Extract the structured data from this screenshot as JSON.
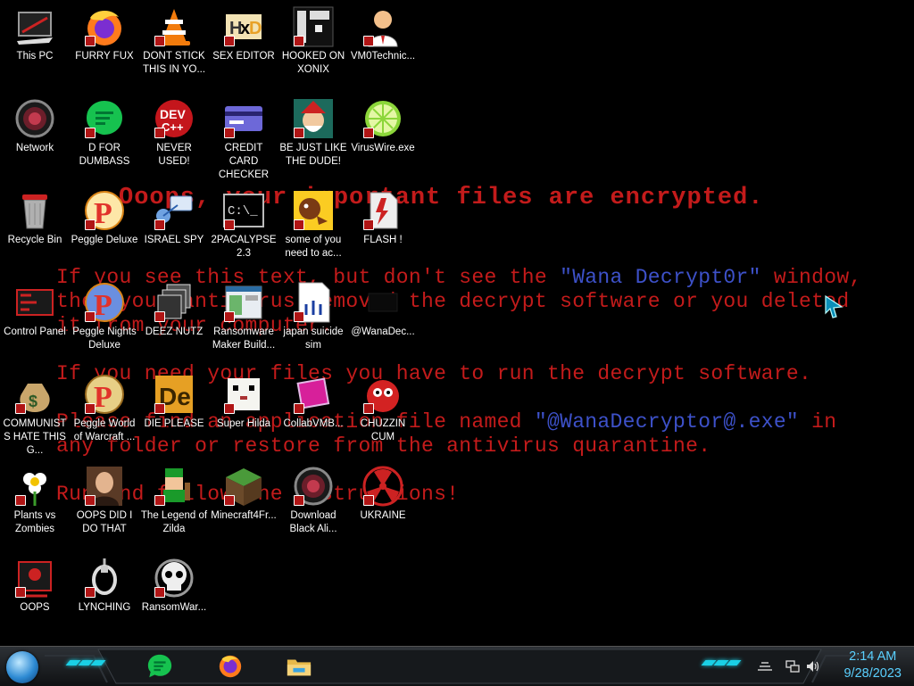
{
  "wallpaper": {
    "title": "Ooops, your important files are encrypted.",
    "p1_a": "If you see this text, but don't see the ",
    "p1_name": "\"Wana Decrypt0r\"",
    "p1_b": " window,",
    "p1_line2": "then your antivirus removed the decrypt software or you deleted",
    "p1_line3": "it from your computer.",
    "p2": "If you need your files you have to run the decrypt software.",
    "p3_a": "Please find an application file named ",
    "p3_name": "\"@WanaDecryptor@.exe\"",
    "p3_b": " in",
    "p3_line2": "any folder or restore from the antivirus quarantine.",
    "p4": "Run and follow the instructions!"
  },
  "icons": [
    {
      "label": "This PC",
      "icon": "this-pc-icon"
    },
    {
      "label": "FURRY FUX",
      "icon": "firefox-icon"
    },
    {
      "label": "DONT STICK THIS IN YO...",
      "icon": "vlc-cone-icon"
    },
    {
      "label": "SEX EDITOR",
      "icon": "hxd-editor-icon"
    },
    {
      "label": "HOOKED ON XONIX",
      "icon": "xonix-icon"
    },
    {
      "label": "VM0Technic...",
      "icon": "doctor-icon"
    },
    {
      "label": "Network",
      "icon": "network-orb-icon"
    },
    {
      "label": "D FOR DUMBASS",
      "icon": "green-chat-icon"
    },
    {
      "label": "NEVER USED!",
      "icon": "dev-cpp-icon"
    },
    {
      "label": "CREDIT CARD CHECKER",
      "icon": "credit-card-icon"
    },
    {
      "label": "BE JUST LIKE THE DUDE!",
      "icon": "santa-dude-icon"
    },
    {
      "label": "VirusWire.exe",
      "icon": "lime-icon"
    },
    {
      "label": "Recycle Bin",
      "icon": "recycle-bin-icon"
    },
    {
      "label": "Peggle Deluxe",
      "icon": "peggle-icon"
    },
    {
      "label": "ISRAEL SPY",
      "icon": "spy-network-icon"
    },
    {
      "label": "2PACALYPSE 2.3",
      "icon": "terminal-icon"
    },
    {
      "label": "some of you need to ac...",
      "icon": "dog-icon"
    },
    {
      "label": "FLASH !",
      "icon": "flash-page-icon"
    },
    {
      "label": "Control Panel",
      "icon": "control-panel-icon"
    },
    {
      "label": "Peggle Nights Deluxe",
      "icon": "peggle-nights-icon"
    },
    {
      "label": "DEEZ NUTZ",
      "icon": "stacked-windows-icon"
    },
    {
      "label": "Ransomware Maker Build...",
      "icon": "app-window-icon"
    },
    {
      "label": "japan suicide sim",
      "icon": "document-icon"
    },
    {
      "label": "@WanaDec...",
      "icon": "wana-decryptor-icon"
    },
    {
      "label": "COMMUNISTS HATE THIS G...",
      "icon": "money-bag-icon"
    },
    {
      "label": "Peggle World of Warcraft ...",
      "icon": "peggle-wow-icon"
    },
    {
      "label": "DIE PLEASE",
      "icon": "de-icon"
    },
    {
      "label": "Super Hilda",
      "icon": "pixel-cat-icon"
    },
    {
      "label": "CollabVMB...",
      "icon": "collabvm-icon"
    },
    {
      "label": "CHUZZIN CUM",
      "icon": "chuzzle-icon"
    },
    {
      "label": "Plants vs Zombies",
      "icon": "flower-icon"
    },
    {
      "label": "OOPS DID I DO THAT",
      "icon": "portrait-icon"
    },
    {
      "label": "The Legend of Zilda",
      "icon": "zelda-sprite-icon"
    },
    {
      "label": "Minecraft4Fr...",
      "icon": "grass-block-icon"
    },
    {
      "label": "Download Black Ali...",
      "icon": "network-orb-icon"
    },
    {
      "label": "UKRAINE",
      "icon": "radiation-icon"
    },
    {
      "label": "OOPS",
      "icon": "oops-window-icon"
    },
    {
      "label": "LYNCHING",
      "icon": "noose-icon"
    },
    {
      "label": "RansomWar...",
      "icon": "skull-icon"
    }
  ],
  "taskbar": {
    "pinned": [
      "green-chat-icon",
      "firefox-icon",
      "file-explorer-icon"
    ],
    "clock_time": "2:14 AM",
    "clock_date": "9/28/2023"
  },
  "colors": {
    "wall_red": "#c31b1b",
    "wall_blue": "#3d51c9",
    "clock": "#5ad0ff",
    "accent_cyan": "#1ad0e6"
  }
}
